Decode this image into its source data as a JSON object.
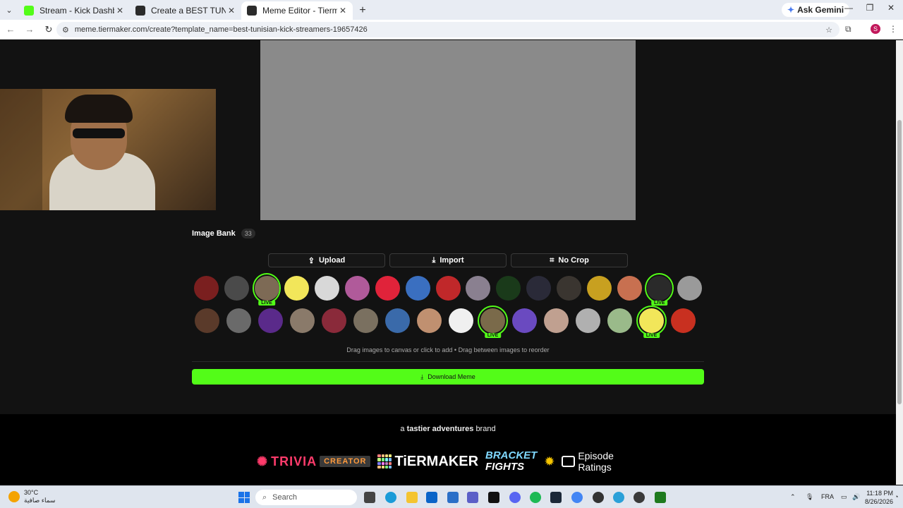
{
  "browser": {
    "tabs": [
      {
        "label": "Stream - Kick Dashboard",
        "favicon_color": "#53fc18",
        "active": false
      },
      {
        "label": "Create a BEST TUNISIAN KICK S",
        "favicon_color": "#2b2b2b",
        "active": false
      },
      {
        "label": "Meme Editor - Tiermaker",
        "favicon_color": "#2b2b2b",
        "active": true
      }
    ],
    "new_tab": "+",
    "ask_gemini": "Ask Gemini",
    "url": "meme.tiermaker.com/create?template_name=best-tunisian-kick-streamers-19657426",
    "profile_initial": "S"
  },
  "page": {
    "bank_title": "Image Bank",
    "bank_count": "33",
    "buttons": {
      "upload": "Upload",
      "import": "Import",
      "no_crop": "No Crop"
    },
    "live_tag": "LIVE",
    "avatars_row1": [
      {
        "color": "#7a1f1f",
        "live": false
      },
      {
        "color": "#4a4a4a",
        "live": false
      },
      {
        "color": "#7d6a55",
        "live": true
      },
      {
        "color": "#f2e65a",
        "live": false
      },
      {
        "color": "#d8d8d8",
        "live": false
      },
      {
        "color": "#b05a9a",
        "live": false
      },
      {
        "color": "#e0233a",
        "live": false
      },
      {
        "color": "#3a6fc0",
        "live": false
      },
      {
        "color": "#c0282a",
        "live": false
      },
      {
        "color": "#8a8090",
        "live": false
      },
      {
        "color": "#1a3a1a",
        "live": false
      },
      {
        "color": "#2a2a38",
        "live": false
      },
      {
        "color": "#3a3530",
        "live": false
      },
      {
        "color": "#c8a020",
        "live": false
      },
      {
        "color": "#c87050",
        "live": false
      },
      {
        "color": "#2a2a2a",
        "live": true
      },
      {
        "color": "#9a9a9a",
        "live": false
      }
    ],
    "avatars_row2": [
      {
        "color": "#5a3a2a",
        "live": false
      },
      {
        "color": "#6a6a6a",
        "live": false
      },
      {
        "color": "#5a2a8a",
        "live": false
      },
      {
        "color": "#8a7a6a",
        "live": false
      },
      {
        "color": "#8a2a3a",
        "live": false
      },
      {
        "color": "#7a7060",
        "live": false
      },
      {
        "color": "#3a6aaa",
        "live": false
      },
      {
        "color": "#c09070",
        "live": false
      },
      {
        "color": "#f0f0f0",
        "live": false
      },
      {
        "color": "#7a6a4a",
        "live": true
      },
      {
        "color": "#6a4ac0",
        "live": false
      },
      {
        "color": "#c0a090",
        "live": false
      },
      {
        "color": "#b0b0b0",
        "live": false
      },
      {
        "color": "#9aba8a",
        "live": false
      },
      {
        "color": "#f2e65a",
        "live": true
      },
      {
        "color": "#c83020",
        "live": false
      }
    ],
    "bank_hint": "Drag images to canvas or click to add • Drag between images to reorder",
    "download_label": "Download Meme",
    "brandline_prefix": "a",
    "brandline_brand": "tastier adventures",
    "brandline_suffix": "brand",
    "logos": {
      "trivia": "TRIVIA",
      "trivia_tag": "CREATOR",
      "tiermaker": "TiERMAKER",
      "bracket_1": "BRACKET",
      "bracket_2": "FIGHTS",
      "episode": "Episode Ratings"
    },
    "accent": "#53fc18"
  },
  "taskbar": {
    "weather_temp": "30°C",
    "weather_desc": "سماء صافية",
    "search_placeholder": "Search",
    "lang": "FRA",
    "time": "11:18 PM",
    "date": "8/26/2026"
  }
}
